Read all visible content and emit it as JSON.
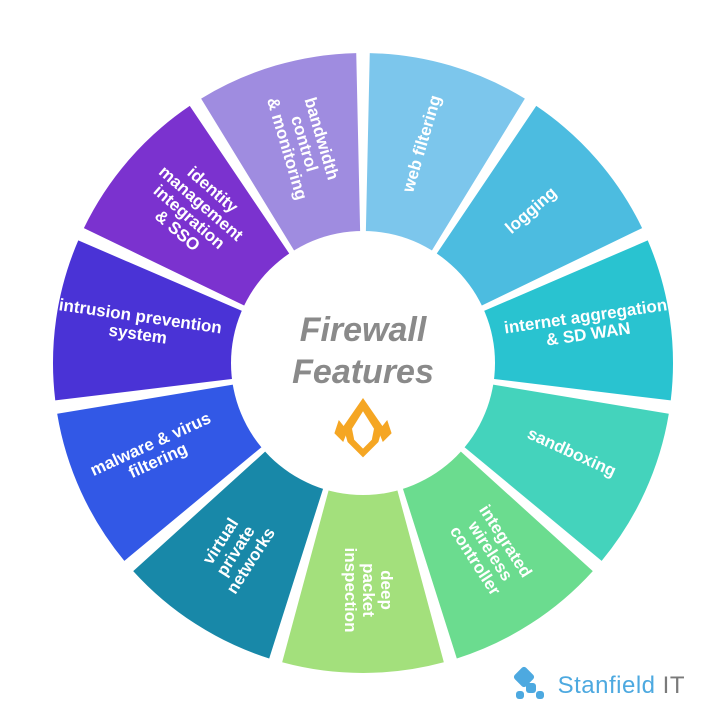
{
  "chart_data": {
    "type": "pie",
    "title": "Firewall Features",
    "slices": [
      {
        "name": "web filtering",
        "color": "#7cc6ec",
        "lines": [
          "web filtering"
        ]
      },
      {
        "name": "logging",
        "color": "#4cbce0",
        "lines": [
          "logging"
        ]
      },
      {
        "name": "internet aggregation & SD WAN",
        "color": "#29c3d0",
        "lines": [
          "internet aggregation",
          "& SD WAN"
        ]
      },
      {
        "name": "sandboxing",
        "color": "#44d3bc",
        "lines": [
          "sandboxing"
        ]
      },
      {
        "name": "integrated wireless controller",
        "color": "#6bdc8f",
        "lines": [
          "integrated",
          "wireless",
          "controller"
        ]
      },
      {
        "name": "deep packet inspection",
        "color": "#a3e07c",
        "lines": [
          "deep",
          "packet",
          "inspection"
        ]
      },
      {
        "name": "virtual private networks",
        "color": "#1888a8",
        "lines": [
          "virtual",
          "private",
          "networks"
        ]
      },
      {
        "name": "malware & virus filtering",
        "color": "#3258e6",
        "lines": [
          "malware & virus",
          "filtering"
        ]
      },
      {
        "name": "intrusion prevention system",
        "color": "#4a33d6",
        "lines": [
          "intrusion prevention",
          "system"
        ]
      },
      {
        "name": "identity management integration & SSO",
        "color": "#7b32cf",
        "lines": [
          "identity",
          "management",
          "integration",
          "& SSO"
        ]
      },
      {
        "name": "bandwidth control & monitoring",
        "color": "#9f8ce0",
        "lines": [
          "bandwidth",
          "control",
          "& monitoring"
        ]
      }
    ]
  },
  "center": {
    "title_line1": "Firewall",
    "title_line2": "Features"
  },
  "logo": {
    "brand_a": "Stanfield",
    "brand_b": " IT"
  }
}
